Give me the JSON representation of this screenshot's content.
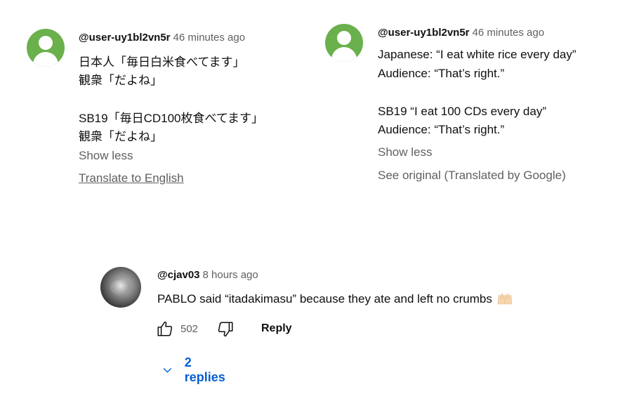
{
  "colors": {
    "avatar_green": "#6ab04c",
    "link_blue": "#065fd4",
    "muted": "#606060",
    "text": "#0f0f0f"
  },
  "original_comment": {
    "author": "@user-uy1bl2vn5r",
    "time": "46 minutes ago",
    "lines": [
      "日本人「毎日白米食べてます」",
      "観衆「だよね」",
      "SB19「毎日CD100枚食べてます」",
      "観衆「だよね」"
    ],
    "show_less": "Show less",
    "translate": "Translate to English"
  },
  "translated_comment": {
    "author": "@user-uy1bl2vn5r",
    "time": "46 minutes ago",
    "lines": [
      "Japanese: “I eat white rice every day”",
      "Audience: “That’s right.”",
      "SB19 “I eat 100 CDs every day”",
      "Audience: “That’s right.”"
    ],
    "show_less": "Show less",
    "see_original": "See original (Translated by Google)"
  },
  "reply_comment": {
    "author": "@cjav03",
    "time": "8 hours ago",
    "text": "PABLO said “itadakimasu” because they ate and left no crumbs",
    "emoji": "raising-hands-emoji",
    "like_count": "502",
    "reply_label": "Reply",
    "replies_label": "2 replies"
  }
}
